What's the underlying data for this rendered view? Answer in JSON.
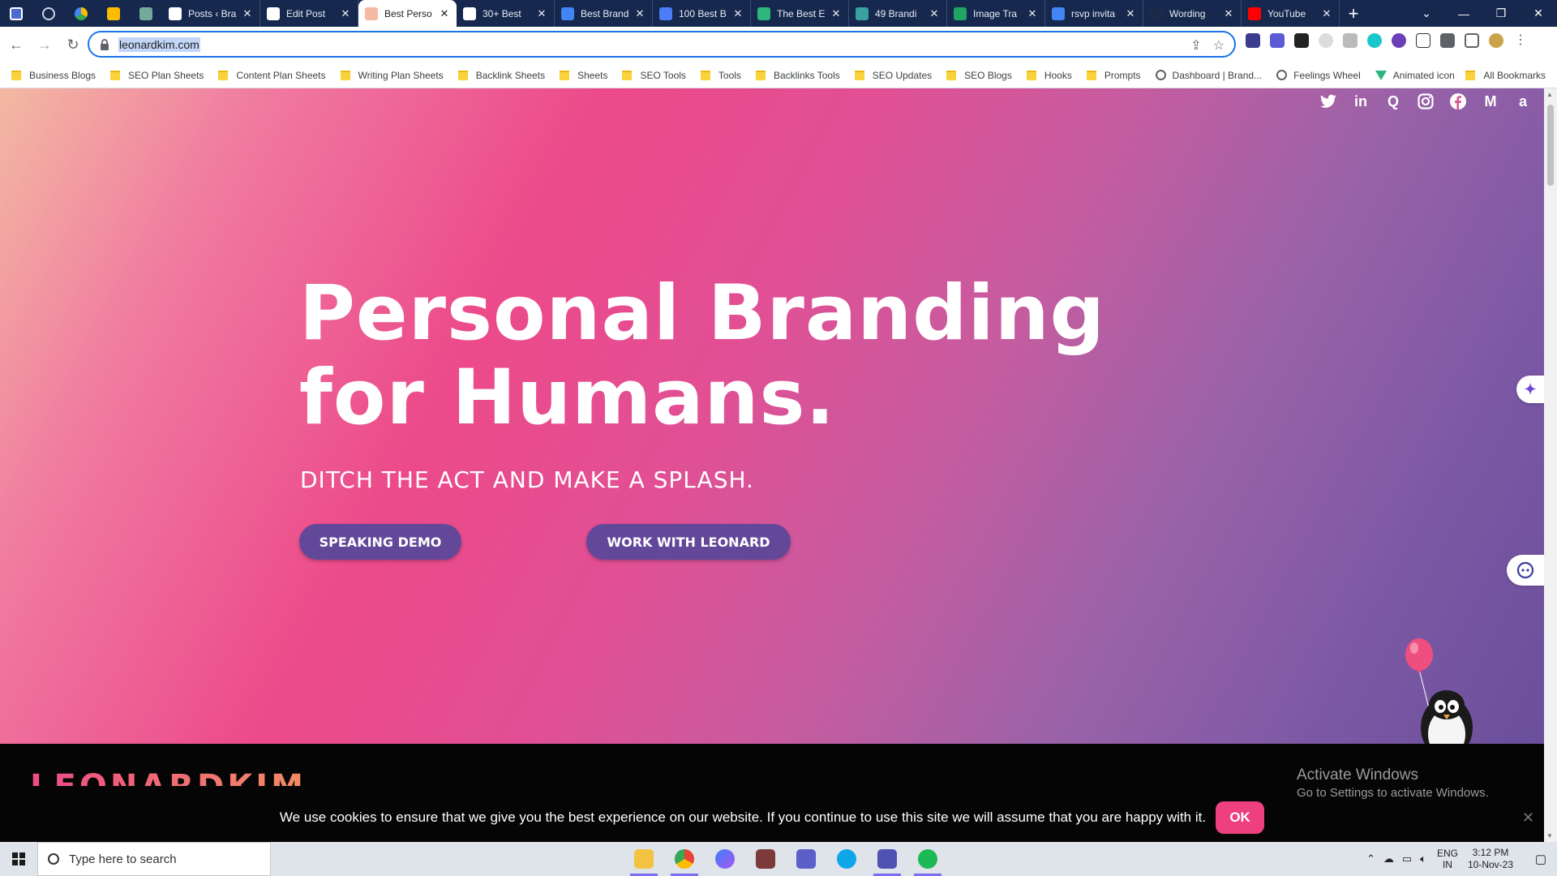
{
  "browser": {
    "tabs": [
      {
        "title": "Posts ‹ Bra",
        "icon_color": "#ffffff"
      },
      {
        "title": "Edit Post",
        "icon_color": "#ffffff"
      },
      {
        "title": "Best Perso",
        "icon_color": "#f3b9a2",
        "active": true
      },
      {
        "title": "30+ Best",
        "icon_color": "#ffffff"
      },
      {
        "title": "Best Brand",
        "icon_color": "#4285f4"
      },
      {
        "title": "100 Best B",
        "icon_color": "#4d7cf7"
      },
      {
        "title": "The Best E",
        "icon_color": "#2cb67d"
      },
      {
        "title": "49 Brandi",
        "icon_color": "#3aa0a0"
      },
      {
        "title": "Image Tra",
        "icon_color": "#1fa463"
      },
      {
        "title": "rsvp invita",
        "icon_color": "#4285f4"
      },
      {
        "title": "Wording",
        "icon_color": "#1c2a4a"
      },
      {
        "title": "YouTube",
        "icon_color": "#ff0000"
      }
    ],
    "pinned_icons": [
      "calendar-icon",
      "settings-icon",
      "drive-icon",
      "keep-icon",
      "chatgpt-icon"
    ],
    "url": "leonardkim.com",
    "bookmarks": [
      {
        "label": "Business Blogs",
        "icon": "folder-icon"
      },
      {
        "label": "SEO Plan Sheets",
        "icon": "folder-icon"
      },
      {
        "label": "Content Plan Sheets",
        "icon": "folder-icon"
      },
      {
        "label": "Writing Plan Sheets",
        "icon": "folder-icon"
      },
      {
        "label": "Backlink Sheets",
        "icon": "folder-icon"
      },
      {
        "label": "Sheets",
        "icon": "folder-icon"
      },
      {
        "label": "SEO Tools",
        "icon": "folder-icon"
      },
      {
        "label": "Tools",
        "icon": "folder-icon"
      },
      {
        "label": "Backlinks Tools",
        "icon": "folder-icon"
      },
      {
        "label": "SEO Updates",
        "icon": "folder-icon"
      },
      {
        "label": "SEO Blogs",
        "icon": "folder-icon"
      },
      {
        "label": "Hooks",
        "icon": "folder-icon"
      },
      {
        "label": "Prompts",
        "icon": "folder-icon"
      },
      {
        "label": "Dashboard | Brand...",
        "icon": "globe-icon"
      },
      {
        "label": "Feelings Wheel",
        "icon": "globe-icon"
      },
      {
        "label": "Animated icon",
        "icon": "vue-icon"
      }
    ],
    "all_bookmarks": "All Bookmarks"
  },
  "page": {
    "headline_line1": "Personal Branding",
    "headline_line2": "for Humans.",
    "subheadline": "DITCH THE ACT AND MAKE A SPLASH.",
    "btn_demo": "SPEAKING DEMO",
    "btn_work": "WORK WITH LEONARD",
    "social_icons": [
      "twitter-icon",
      "linkedin-icon",
      "quora-icon",
      "instagram-icon",
      "facebook-icon",
      "medium-icon",
      "amazon-icon"
    ],
    "logo_text": "LEONARDKIM",
    "cookie_message": "We use cookies to ensure that we give you the best experience on our website. If you continue to use this site we will assume that you are happy with it.",
    "cookie_ok": "OK",
    "colors": {
      "button": "#63489a",
      "cookie_ok": "#ee3f7e",
      "gradient_start": "#f3b9a2",
      "gradient_mid": "#ec4a8a",
      "gradient_end": "#6a4f9c"
    }
  },
  "windows": {
    "activate_title": "Activate Windows",
    "activate_sub": "Go to Settings to activate Windows.",
    "search_placeholder": "Type here to search",
    "lang_line1": "ENG",
    "lang_line2": "IN",
    "time": "3:12 PM",
    "date": "10-Nov-23",
    "taskbar_apps": [
      "file-explorer-icon",
      "chrome-icon",
      "copilot-icon",
      "app-icon",
      "teams-icon",
      "skype-icon",
      "teams-work-icon",
      "spotify-icon"
    ]
  }
}
